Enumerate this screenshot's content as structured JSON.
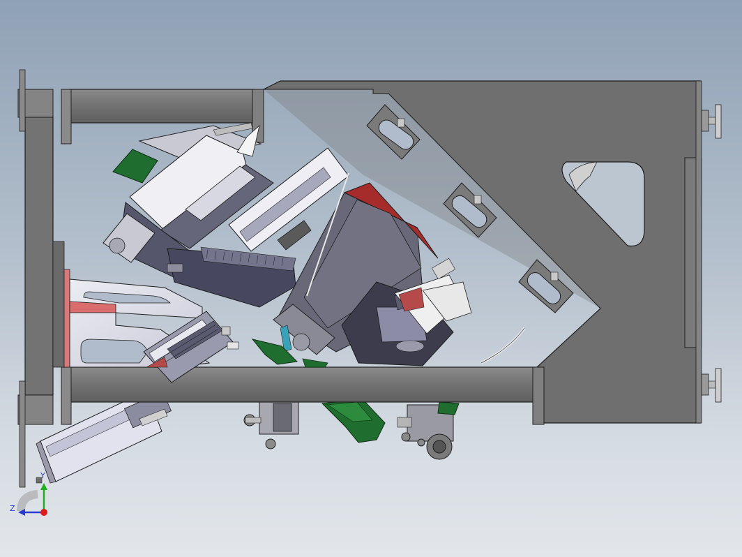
{
  "viewport": {
    "background_top": "#8fa1b5",
    "background_bottom": "#e2e6ea"
  },
  "colors": {
    "frame": "#707070",
    "frame_edge": "#1e1e1e",
    "plate_light": "#d9d9e8",
    "module_dark": "#53536b",
    "pcb_green": "#1f6e2f",
    "accent_red": "#b64a4a",
    "axis_y": "#1db11d",
    "axis_z": "#2a3bd1",
    "axis_origin": "#e01a1a"
  },
  "triad": {
    "y_label": "Y",
    "z_label": "Z"
  },
  "icons": [
    "coordinate-triad-icon",
    "y-axis-arrow-icon",
    "z-axis-arrow-icon",
    "origin-x-axis-icon"
  ]
}
